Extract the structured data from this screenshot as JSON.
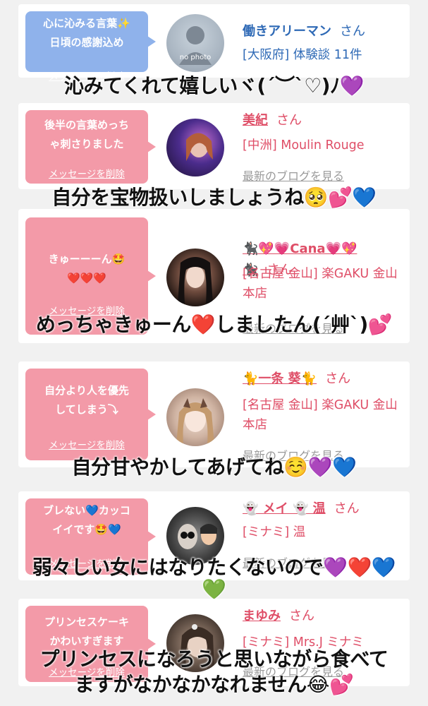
{
  "cards": [
    {
      "bubble_text": "心に沁みる言葉✨\n日頃の感謝込め",
      "delete_label": "メッセージを削除",
      "name": "働きアリーマン",
      "honorific": "さん",
      "shop": "[大阪府] 体験談 11件",
      "avatar_text": "no photo",
      "caption": "沁みてくれて嬉しいヾ(´︶`♡)ﾉ💜"
    },
    {
      "bubble_text": "後半の言葉めっち\nゃ刺さりました",
      "delete_label": "メッセージを削除",
      "name": "美紀",
      "honorific": "さん",
      "shop": "[中洲] Moulin Rouge",
      "blog_label": "最新のブログを見る",
      "caption": "自分を宝物扱いしましょうね🥺💕💙"
    },
    {
      "bubble_text": "きゅーーーん🤩\n❤️❤️❤️",
      "delete_label": "メッセージを削除",
      "name": "🐈‍⬛💖💗Cana💗💖\n🐈‍⬛",
      "honorific": "さん",
      "shop": "[名古屋 金山] 楽GAKU 金山本店",
      "blog_label": "最新のブログを見る",
      "caption": "めっちゃきゅーん❤️しましたん(´艸`)💕"
    },
    {
      "bubble_text": "自分より人を優先\nしてしまう⤵︎",
      "delete_label": "メッセージを削除",
      "name": "🐈一条 葵🐈",
      "honorific": "さん",
      "shop": "[名古屋 金山] 楽GAKU 金山本店",
      "blog_label": "最新のブログを見る",
      "caption": "自分甘やかしてあげてね☺️💜💙"
    },
    {
      "bubble_text": "ブレない💙カッコ\nイイです🤩💙",
      "delete_label": "メッセージを削除",
      "name": "👻 メイ 👻 温",
      "honorific": "さん",
      "shop": "[ミナミ] 温",
      "blog_label": "最新のブログを見る",
      "caption": "弱々しい女にはなりたくないので💜❤️💙",
      "caption_line2": "💚"
    },
    {
      "bubble_text": "プリンセスケーキ\nかわいすぎます",
      "delete_label": "メッセージを削除",
      "name": "まゆみ",
      "honorific": "さん",
      "shop": "[ミナミ] Mrs.J ミナミ",
      "blog_label": "最新のブログを見る",
      "caption": "プリンセスになろうと思いながら食べて",
      "caption_line2": "ますがなかなかなれません😂💕"
    }
  ],
  "colors": {
    "pink_bubble": "#f39aa8",
    "blue_bubble": "#8fb2eb",
    "name_pink": "#df4e67",
    "name_blue": "#2f6ab6",
    "background": "#f1f1f1"
  }
}
